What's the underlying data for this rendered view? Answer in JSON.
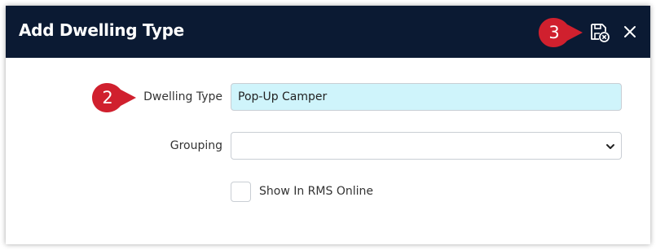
{
  "dialog": {
    "title": "Add Dwelling Type",
    "header_color": "#0b1a33",
    "save_close_icon": "save-and-close-icon",
    "close_icon": "close-icon"
  },
  "markers": {
    "field_marker": "2",
    "save_marker": "3",
    "color": "#d0202e"
  },
  "form": {
    "dwelling_type_label": "Dwelling Type",
    "dwelling_type_value": "Pop-Up Camper",
    "grouping_label": "Grouping",
    "grouping_value": "",
    "show_online_label": "Show In RMS Online",
    "show_online_checked": false
  }
}
